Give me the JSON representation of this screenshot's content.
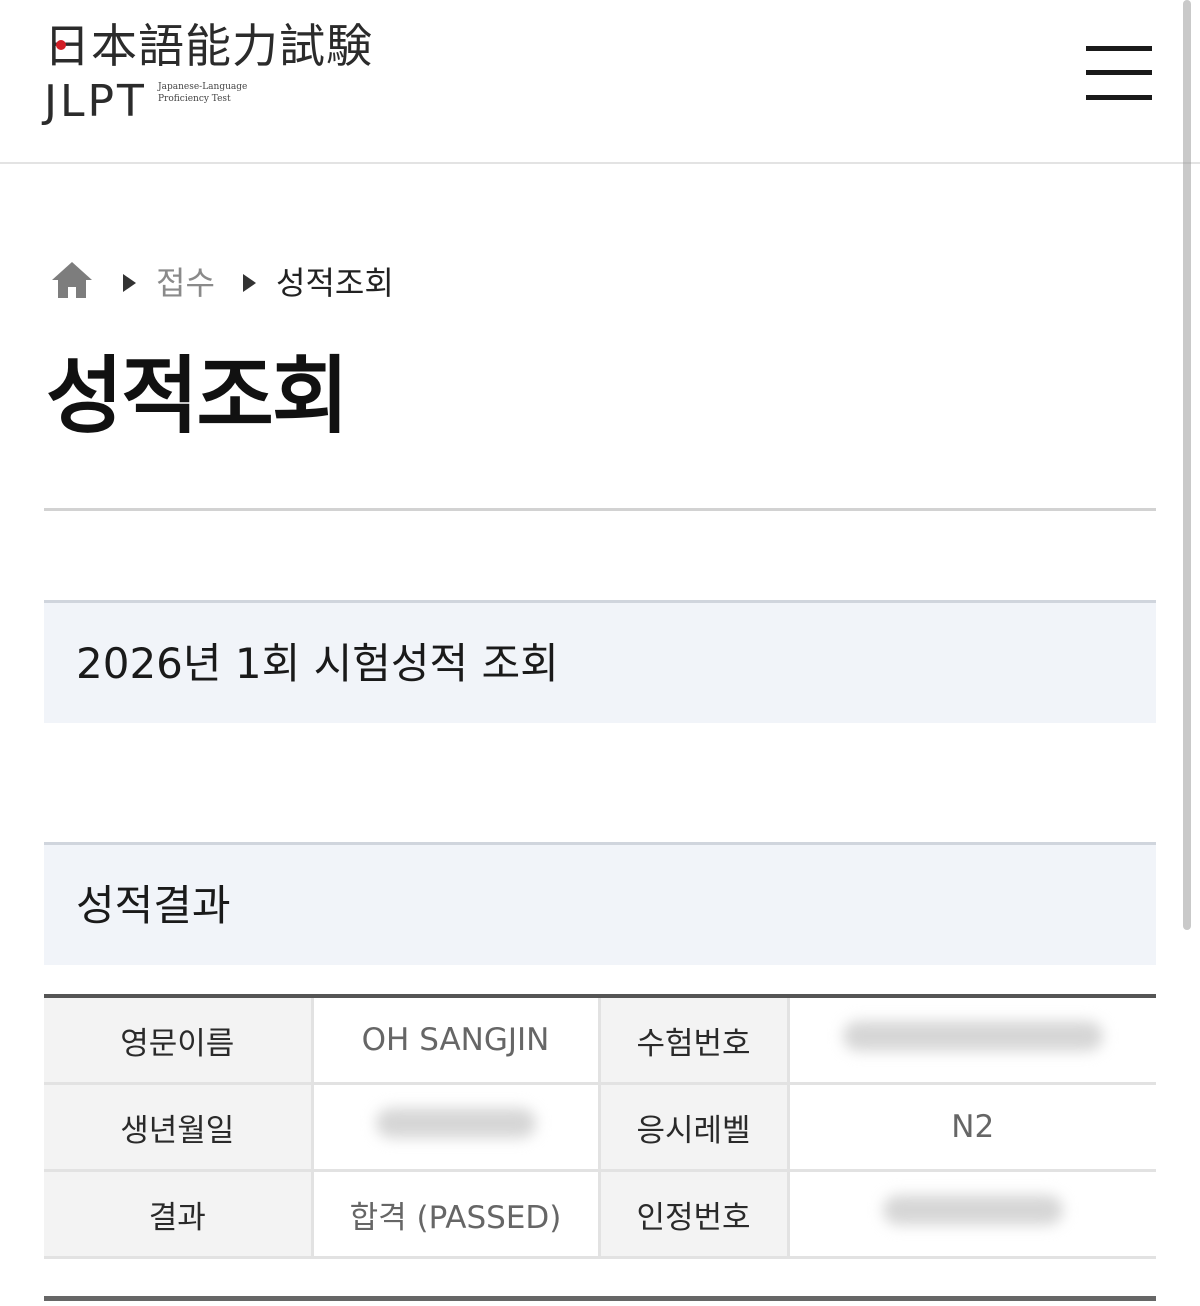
{
  "header": {
    "logo_kanji_first": "日",
    "logo_kanji_rest": "本語能力試験",
    "logo_jlpt": "JLPT",
    "logo_sub": "Japanese-Language Proficiency Test",
    "menu_icon": "hamburger-menu-icon"
  },
  "breadcrumb": {
    "home_icon": "home-icon",
    "items": [
      "접수",
      "성적조회"
    ]
  },
  "page_title": "성적조회",
  "sections": {
    "exam_title": "2026년 1회 시험성적 조회",
    "result_title": "성적결과"
  },
  "result_table": {
    "rows": [
      {
        "label1": "영문이름",
        "value1": "OH SANGJIN",
        "label2": "수험번호",
        "value2": ""
      },
      {
        "label1": "생년월일",
        "value1": "",
        "label2": "응시레벨",
        "value2": "N2"
      },
      {
        "label1": "결과",
        "value1": "합격 (PASSED)",
        "label2": "인정번호",
        "value2": ""
      }
    ]
  },
  "colors": {
    "accent_red": "#d21f27",
    "section_bg": "#f1f4f9"
  }
}
